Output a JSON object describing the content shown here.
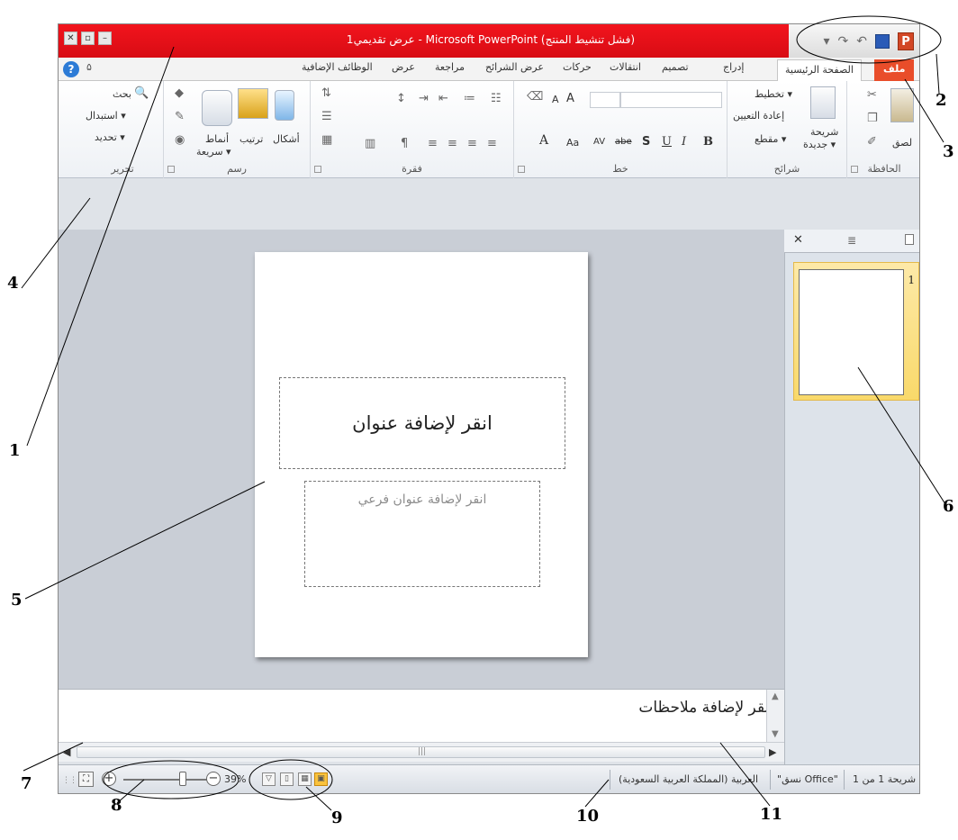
{
  "window": {
    "title": "عرض تقديمي1 - Microsoft PowerPoint (فشل تنشيط المنتج)",
    "controls": {
      "close": "✕",
      "restore": "▫",
      "minimize": "–"
    }
  },
  "quick_access": {
    "customize": "▾",
    "redo": "↷",
    "undo": "↶",
    "save": "save-icon",
    "app_logo": "P"
  },
  "tabs": {
    "file": "ملف",
    "home": "الصفحة الرئيسية",
    "insert": "إدراج",
    "design": "تصميم",
    "transitions": "انتقالات",
    "animations": "حركات",
    "slideshow": "عرض الشرائح",
    "review": "مراجعة",
    "view": "عرض",
    "addins": "الوظائف الإضافية",
    "help": "?",
    "minimize_ribbon": "۵"
  },
  "ribbon": {
    "clipboard": {
      "label": "الحافظة",
      "paste": "لصق"
    },
    "slides": {
      "label": "شرائح",
      "new_slide": "شريحة",
      "new_slide_2": "جديدة ▾",
      "layout": "تخطيط ▾",
      "reset": "إعادة التعيين",
      "section": "مقطع ▾"
    },
    "font": {
      "label": "خط",
      "bold": "B",
      "italic": "I",
      "underline": "U",
      "shadow": "S",
      "strike": "abe",
      "spacing": "AV",
      "case": "Aa",
      "color": "A",
      "grow": "A",
      "shrink": "A"
    },
    "paragraph": {
      "label": "فقرة"
    },
    "drawing": {
      "label": "رسم",
      "shapes": "أشكال",
      "arrange": "ترتيب",
      "quick_styles": "أنماط",
      "quick_styles_2": "سريعة ▾"
    },
    "editing": {
      "label": "تحرير",
      "find": "بحث",
      "replace": "استبدال ▾",
      "select": "تحديد ▾"
    }
  },
  "thumbnails": {
    "close": "✕",
    "slide_number": "1"
  },
  "slide": {
    "title_placeholder": "انقر لإضافة عنوان",
    "subtitle_placeholder": "انقر لإضافة عنوان فرعي"
  },
  "notes": {
    "placeholder": "انقر لإضافة ملاحظات"
  },
  "status": {
    "slide_info": "شريحة 1 من 1",
    "theme": "\"نسق Office\"",
    "language": "العربية (المملكة العربية السعودية)",
    "zoom": "39%",
    "zoom_in": "+",
    "zoom_out": "−"
  },
  "callouts": [
    "1",
    "2",
    "3",
    "4",
    "5",
    "6",
    "7",
    "8",
    "9",
    "10",
    "11"
  ]
}
